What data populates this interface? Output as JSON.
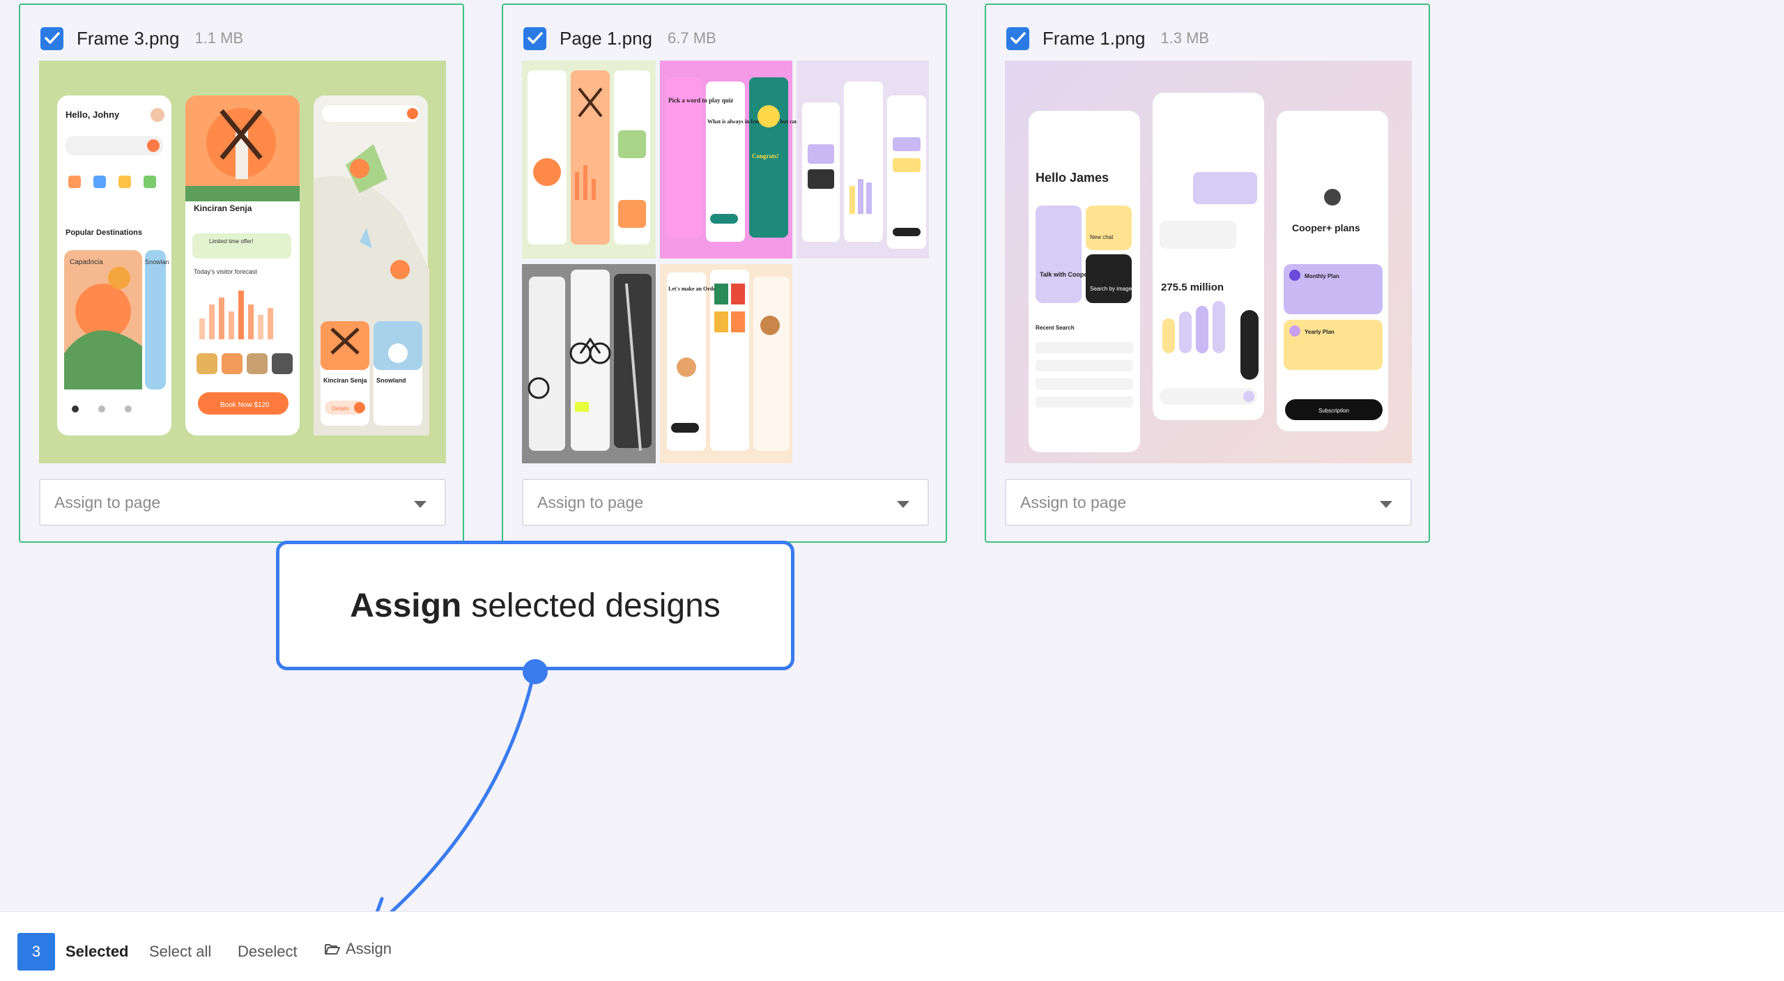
{
  "cards": [
    {
      "checked": true,
      "file_name": "Frame 3.png",
      "file_size": "1.1 MB",
      "select": {
        "placeholder": "Assign to page"
      },
      "thumb_text": [
        "Hello, Johny",
        "Popular Destinations",
        "Capadocia",
        "Snowlan",
        "Kinciran Senja",
        "Limited time offer!",
        "Today's visitor forecast",
        "Book Now $120",
        "Kinciran Senja",
        "Snowland",
        "Details"
      ]
    },
    {
      "checked": true,
      "file_name": "Page 1.png",
      "file_size": "6.7 MB",
      "select": {
        "placeholder": "Assign to page"
      },
      "thumb_text": [
        "Pick a word to play quiz",
        "What is always in front of you but can't be seen?",
        "Congrats!",
        "Let's make an Order"
      ]
    },
    {
      "checked": true,
      "file_name": "Frame 1.png",
      "file_size": "1.3 MB",
      "select": {
        "placeholder": "Assign to page"
      },
      "thumb_text": [
        "Hello James",
        "Talk with Cooper",
        "New chat",
        "Search by image",
        "Recent Search",
        "275.5 million",
        "Cooper+ plans",
        "Monthly Plan",
        "Yearly Plan",
        "Subscription"
      ]
    }
  ],
  "callout": {
    "bold": "Assign",
    "rest": "selected designs"
  },
  "bottom_bar": {
    "count": "3",
    "selected_label": "Selected",
    "select_all": "Select all",
    "deselect": "Deselect",
    "assign": "Assign"
  },
  "colors": {
    "accent": "#2c7be5",
    "card_border": "#3fbf7f",
    "callout_border": "#3a7bef",
    "page_bg": "#f3f3f9"
  }
}
